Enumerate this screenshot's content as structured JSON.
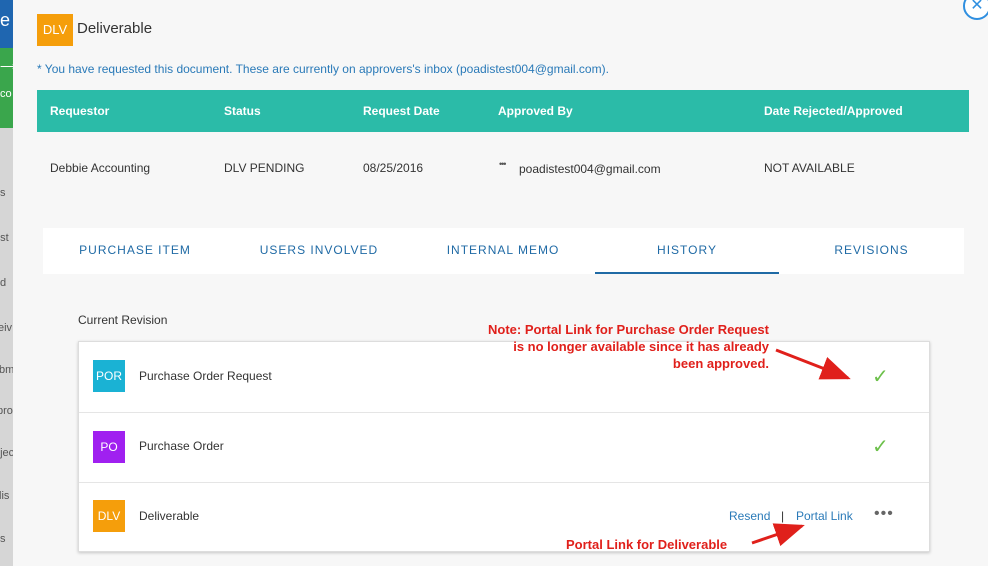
{
  "background": {
    "fragments": [
      "le",
      "⟶",
      "co",
      "s",
      "est",
      "d",
      "eiv",
      "bm",
      "pro",
      "ojec",
      "lis",
      "s"
    ]
  },
  "modal": {
    "close_icon": "✕",
    "title_badge": "DLV",
    "title": "Deliverable",
    "notice": "* You have requested this document. These are currently on approvers's inbox (poadistest004@gmail.com)."
  },
  "table": {
    "headers": [
      "Requestor",
      "Status",
      "Request Date",
      "Approved By",
      "Date Rejected/Approved"
    ],
    "row": {
      "requestor": "Debbie Accounting",
      "status": "DLV PENDING",
      "request_date": "08/25/2016",
      "approved_by_icon": "•••",
      "approved_by": "poadistest004@gmail.com",
      "date": "NOT AVAILABLE"
    }
  },
  "tabs": [
    {
      "label": "PURCHASE ITEM"
    },
    {
      "label": "USERS INVOLVED"
    },
    {
      "label": "INTERNAL MEMO"
    },
    {
      "label": "HISTORY",
      "active": true
    },
    {
      "label": "REVISIONS"
    }
  ],
  "revision": {
    "heading": "Current Revision",
    "items": [
      {
        "badge": "POR",
        "badge_color": "#1ab2d4",
        "label": "Purchase Order Request",
        "status_icon": "✓"
      },
      {
        "badge": "PO",
        "badge_color": "#a020f0",
        "label": "Purchase Order",
        "status_icon": "✓"
      },
      {
        "badge": "DLV",
        "badge_color": "#f59e0b",
        "label": "Deliverable",
        "resend": "Resend",
        "separator": "|",
        "portal_link": "Portal Link",
        "more_icon": "•••"
      }
    ]
  },
  "annotations": {
    "note_lines": [
      "Note: Portal Link for Purchase Order Request",
      "is no longer available since it has already",
      "been approved."
    ],
    "portal_note": "Portal Link for Deliverable"
  },
  "colors": {
    "teal_header": "#2bbba8",
    "link_blue": "#2a7ab8",
    "annotation_red": "#e0201b",
    "check_green": "#6cc04a"
  }
}
